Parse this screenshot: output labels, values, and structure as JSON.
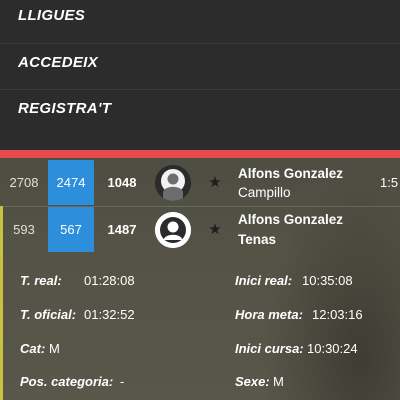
{
  "menu": {
    "items": [
      {
        "label": "LLIGUES"
      },
      {
        "label": "ACCEDEIX"
      },
      {
        "label": "REGISTRA'T"
      }
    ]
  },
  "colors": {
    "accent_red": "#e74a4a",
    "category_blue": "#2d8fdb",
    "selected_accent": "#c9c241"
  },
  "results": [
    {
      "position": "2708",
      "category_position": "2474",
      "dorsal": "1048",
      "avatar": "user-photo",
      "name_line1": "Alfons Gonzalez",
      "name_line2": "Campillo",
      "time_partial": "1:5"
    },
    {
      "position": "593",
      "category_position": "567",
      "dorsal": "1487",
      "avatar": "user-placeholder",
      "name_line1": "Alfons Gonzalez",
      "name_line2": "Tenas"
    }
  ],
  "detail": {
    "t_real": {
      "label": "T. real:",
      "value": "01:28:08"
    },
    "inici_real": {
      "label": "Inici real:",
      "value": "10:35:08"
    },
    "t_oficial": {
      "label": "T. oficial:",
      "value": "01:32:52"
    },
    "hora_meta": {
      "label": "Hora meta:",
      "value": "12:03:16"
    },
    "cat": {
      "label": "Cat:",
      "value": "M"
    },
    "inici_cursa": {
      "label": "Inici cursa:",
      "value": "10:30:24"
    },
    "pos_categoria": {
      "label": "Pos. categoria:",
      "value": "-"
    },
    "sexe": {
      "label": "Sexe:",
      "value": "M"
    }
  }
}
